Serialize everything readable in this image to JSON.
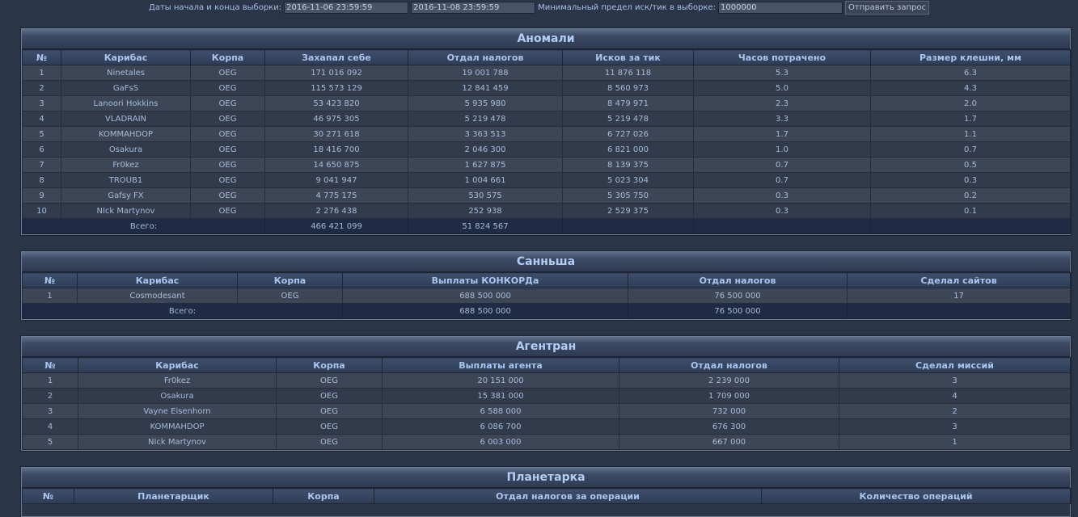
{
  "filters": {
    "dates_label": "Даты начала и конца выборки:",
    "date_start": "2016-11-06 23:59:59",
    "date_end": "2016-11-08 23:59:59",
    "min_label": "Минимальный предел иск/тик в выборке:",
    "min_value": "1000000",
    "submit_label": "Отправить запрос"
  },
  "anomalies": {
    "title": "Аномали",
    "headers": [
      "№",
      "Карибас",
      "Корпа",
      "Захапал себе",
      "Отдал налогов",
      "Исков за тик",
      "Часов потрачено",
      "Размер клешни, мм"
    ],
    "rows": [
      [
        "1",
        "Ninetales",
        "OEG",
        "171 016 092",
        "19 001 788",
        "11 876 118",
        "5.3",
        "6.3"
      ],
      [
        "2",
        "GaFsS",
        "OEG",
        "115 573 129",
        "12 841 459",
        "8 560 973",
        "5.0",
        "4.3"
      ],
      [
        "3",
        "Lanoori Hokkins",
        "OEG",
        "53 423 820",
        "5 935 980",
        "8 479 971",
        "2.3",
        "2.0"
      ],
      [
        "4",
        "VLADRAIN",
        "OEG",
        "46 975 305",
        "5 219 478",
        "5 219 478",
        "3.3",
        "1.7"
      ],
      [
        "5",
        "KOMMAHDOP",
        "OEG",
        "30 271 618",
        "3 363 513",
        "6 727 026",
        "1.7",
        "1.1"
      ],
      [
        "6",
        "Osakura",
        "OEG",
        "18 416 700",
        "2 046 300",
        "6 821 000",
        "1.0",
        "0.7"
      ],
      [
        "7",
        "Fr0kez",
        "OEG",
        "14 650 875",
        "1 627 875",
        "8 139 375",
        "0.7",
        "0.5"
      ],
      [
        "8",
        "TROUB1",
        "OEG",
        "9 041 947",
        "1 004 661",
        "5 023 304",
        "0.7",
        "0.3"
      ],
      [
        "9",
        "Gafsy FX",
        "OEG",
        "4 775 175",
        "530 575",
        "5 305 750",
        "0.3",
        "0.2"
      ],
      [
        "10",
        "NIck Martynov",
        "OEG",
        "2 276 438",
        "252 938",
        "2 529 375",
        "0.3",
        "0.1"
      ]
    ],
    "total": {
      "label": "Всего:",
      "col1": "466 421 099",
      "col2": "51 824 567"
    }
  },
  "sansha": {
    "title": "Санньша",
    "headers": [
      "№",
      "Карибас",
      "Корпа",
      "Выплаты КОНКОРДа",
      "Отдал налогов",
      "Сделал сайтов"
    ],
    "rows": [
      [
        "1",
        "Cosmodesant",
        "OEG",
        "688 500 000",
        "76 500 000",
        "17"
      ]
    ],
    "total": {
      "label": "Всего:",
      "col1": "688 500 000",
      "col2": "76 500 000"
    }
  },
  "agents": {
    "title": "Агентран",
    "headers": [
      "№",
      "Карибас",
      "Корпа",
      "Выплаты агента",
      "Отдал налогов",
      "Сделал миссий"
    ],
    "rows": [
      [
        "1",
        "Fr0kez",
        "OEG",
        "20 151 000",
        "2 239 000",
        "3"
      ],
      [
        "2",
        "Osakura",
        "OEG",
        "15 381 000",
        "1 709 000",
        "4"
      ],
      [
        "3",
        "Vayne Eisenhorn",
        "OEG",
        "6 588 000",
        "732 000",
        "2"
      ],
      [
        "4",
        "KOMMAHDOP",
        "OEG",
        "6 086 700",
        "676 300",
        "3"
      ],
      [
        "5",
        "NIck Martynov",
        "OEG",
        "6 003 000",
        "667 000",
        "1"
      ]
    ]
  },
  "planet": {
    "title": "Планетарка",
    "headers": [
      "№",
      "Планетарщик",
      "Корпа",
      "Отдал налогов за операции",
      "Количество операций"
    ]
  }
}
